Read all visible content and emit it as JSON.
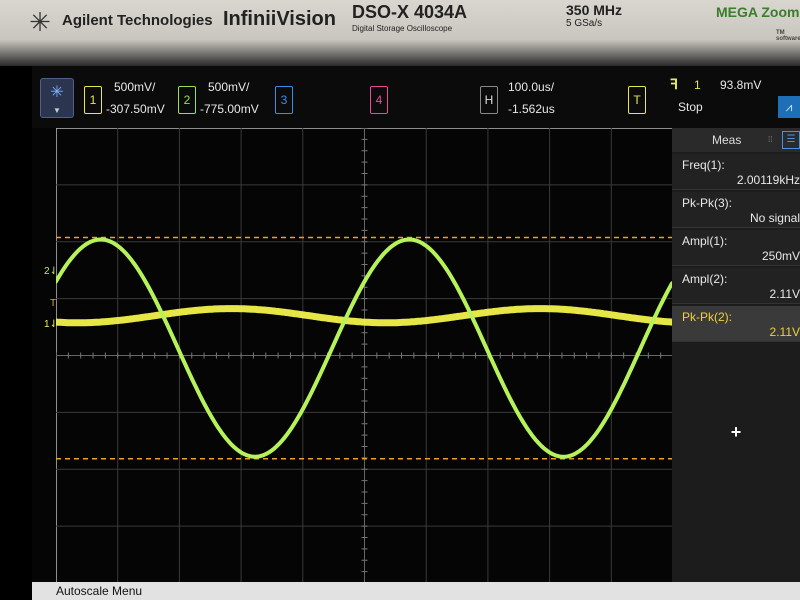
{
  "bezel": {
    "brand": "Agilent Technologies",
    "series": "InfiniiVision",
    "model": "DSO-X 4034A",
    "model_sub": "Digital Storage Oscilloscope",
    "bandwidth": "350 MHz",
    "sample_rate": "5 GSa/s",
    "logo_text": "MEGA Zoom",
    "logo_tag": "TM software"
  },
  "channels": [
    {
      "num": "1",
      "scale": "500mV/",
      "offset": "-307.50mV",
      "color": "#e8e84a"
    },
    {
      "num": "2",
      "scale": "500mV/",
      "offset": "-775.00mV",
      "color": "#9be04a"
    },
    {
      "num": "3",
      "color": "#3a8fe8"
    },
    {
      "num": "4",
      "color": "#e84a9a"
    }
  ],
  "horizontal": {
    "label": "H",
    "scale": "100.0us/",
    "delay": "-1.562us"
  },
  "trigger": {
    "label": "T",
    "edge_icon": "rising-edge-icon",
    "source": "1",
    "level": "93.8mV",
    "status": "Stop"
  },
  "markers": {
    "ch2": "2",
    "trig": "T",
    "ch1": "1"
  },
  "measurements": {
    "title": "Meas",
    "items": [
      {
        "label": "Freq(1):",
        "value": "2.00119kHz"
      },
      {
        "label": "Pk-Pk(3):",
        "value": "No signal"
      },
      {
        "label": "Ampl(1):",
        "value": "250mV"
      },
      {
        "label": "Ampl(2):",
        "value": "2.11V"
      },
      {
        "label": "Pk-Pk(2):",
        "value": "2.11V",
        "selected": true
      }
    ],
    "add_label": "+"
  },
  "status_bar": {
    "text": "Autoscale Menu"
  },
  "waveforms": {
    "grid_divisions_x": 10,
    "grid_divisions_y": 8,
    "ch1_sine_amplitude_div": 0.125,
    "ch2_sine_amplitude_div": 1.91,
    "cycles_on_screen": 2.0,
    "phase_offset_div": 0.6
  },
  "colors": {
    "trace_ch1": "#f2f24a",
    "trace_ch2": "#b6f25a",
    "grid": "#3a3a3a",
    "cursor": "#f0a020",
    "background": "#050505"
  }
}
